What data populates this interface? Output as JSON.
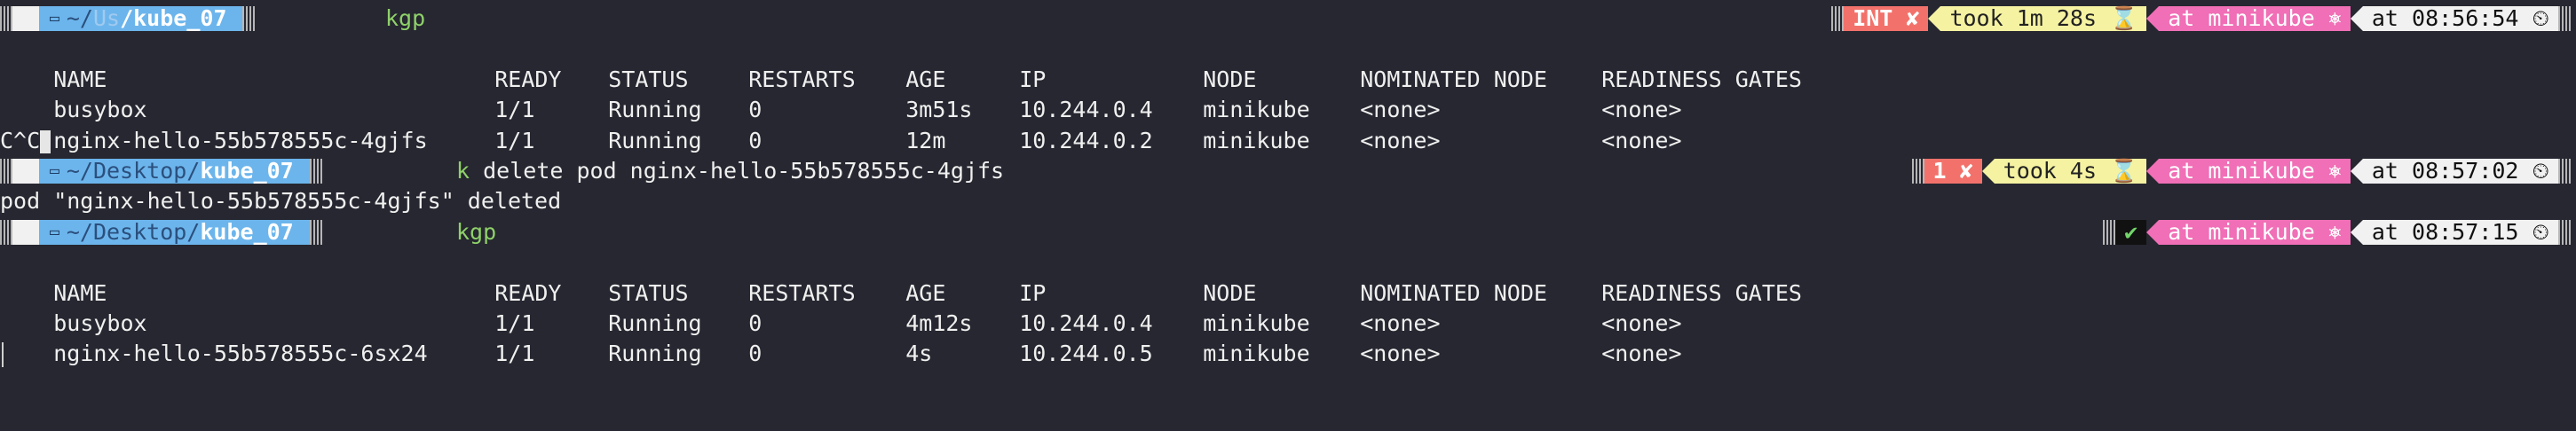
{
  "prompts": [
    {
      "apple": "",
      "dir_home": "~/",
      "dir_mid": "Us",
      "dir_leaf": "/kube_07",
      "command": "kgp",
      "command_rest": "",
      "status": "INT ✘",
      "took": "took 1m 28s ⌛",
      "context": "at minikube ⎈",
      "time": "at 08:56:54 ⏲"
    },
    {
      "apple": "",
      "dir_home": "~/",
      "dir_mid": "Desktop/",
      "dir_leaf": "kube_07",
      "command": "k",
      "command_rest": " delete pod nginx-hello-55b578555c-4gjfs",
      "status": "1 ✘",
      "took": "took 4s ⌛",
      "context": "at minikube ⎈",
      "time": "at 08:57:02 ⏲"
    },
    {
      "apple": "",
      "dir_home": "~/",
      "dir_mid": "Desktop/",
      "dir_leaf": "kube_07",
      "command": "kgp",
      "command_rest": "",
      "status": "✔",
      "context": "at minikube ⎈",
      "time": "at 08:57:15 ⏲"
    }
  ],
  "tables": [
    {
      "headers": [
        "NAME",
        "READY",
        "STATUS",
        "RESTARTS",
        "AGE",
        "IP",
        "NODE",
        "NOMINATED NODE",
        "READINESS GATES"
      ],
      "rows": [
        [
          "busybox",
          "1/1",
          "Running",
          "0",
          "3m51s",
          "10.244.0.4",
          "minikube",
          "<none>",
          "<none>"
        ],
        [
          "nginx-hello-55b578555c-4gjfs",
          "1/1",
          "Running",
          "0",
          "12m",
          "10.244.0.2",
          "minikube",
          "<none>",
          "<none>"
        ]
      ]
    },
    {
      "headers": [
        "NAME",
        "READY",
        "STATUS",
        "RESTARTS",
        "AGE",
        "IP",
        "NODE",
        "NOMINATED NODE",
        "READINESS GATES"
      ],
      "rows": [
        [
          "busybox",
          "1/1",
          "Running",
          "0",
          "4m12s",
          "10.244.0.4",
          "minikube",
          "<none>",
          "<none>"
        ],
        [
          "nginx-hello-55b578555c-6sx24",
          "1/1",
          "Running",
          "0",
          "4s",
          "10.244.0.5",
          "minikube",
          "<none>",
          "<none>"
        ]
      ]
    }
  ],
  "interrupt_text": "C^C",
  "delete_output": "pod \"nginx-hello-55b578555c-4gjfs\" deleted",
  "colors": {
    "background": "#262730",
    "dir_segment": "#6cb5ec",
    "command": "#8fd16a",
    "error_segment": "#f2726b",
    "took_segment": "#f5f2a2",
    "context_segment": "#f06fb6",
    "ok_segment": "#111111"
  }
}
